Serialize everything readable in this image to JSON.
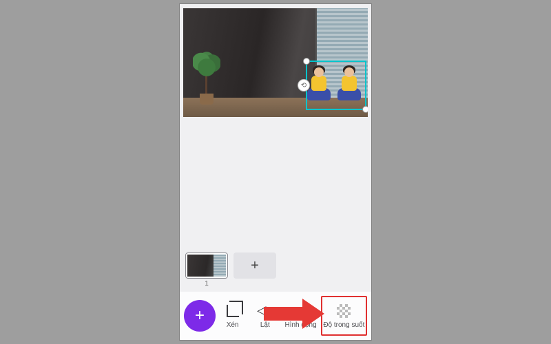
{
  "thumbs": {
    "page1_label": "1"
  },
  "toolbar": {
    "crop_label": "Xén",
    "flip_label": "Lật",
    "animate_label": "Hình động",
    "transparency_label": "Độ trong suốt"
  },
  "icons": {
    "add": "+",
    "add_page": "+",
    "rotate": "⟲",
    "flip_glyph": "◁▷"
  }
}
